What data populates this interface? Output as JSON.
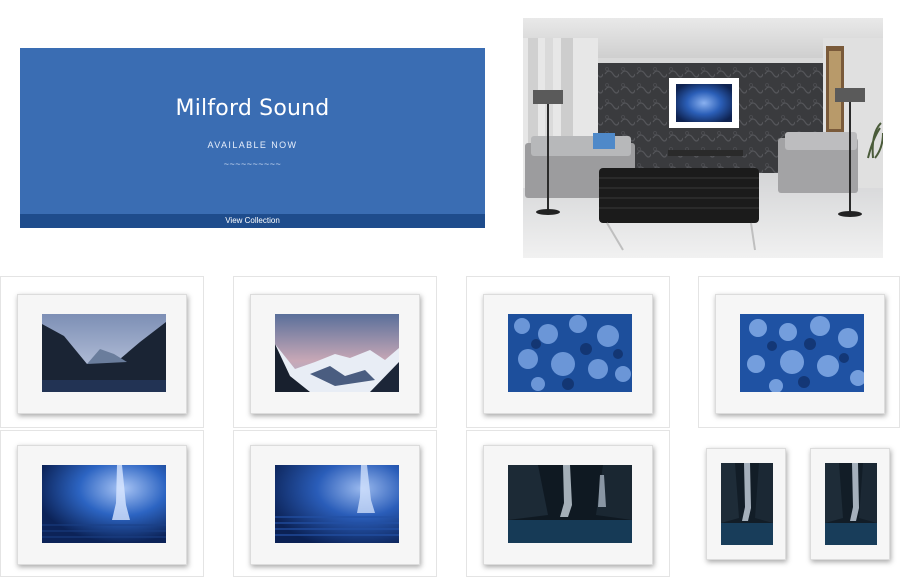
{
  "banner": {
    "title": "Milford Sound",
    "subtitle": "AVAILABLE NOW",
    "divider": "~~~~~~~~~~",
    "cta_label": "View Collection",
    "color": "#3a6db3",
    "cta_color": "#1e4c8c"
  },
  "room_scene": {
    "description_icon": "room-interior-image"
  },
  "gallery": {
    "items": [
      {
        "subject": "fjord-dusk"
      },
      {
        "subject": "fjord-snowy-peaks"
      },
      {
        "subject": "blue-water-texture"
      },
      {
        "subject": "blue-water-texture"
      },
      {
        "subject": "waterfall-mist"
      },
      {
        "subject": "waterfall-ripples"
      },
      {
        "subject": "waterfall-dark"
      },
      {
        "subject": "waterfall-portrait"
      },
      {
        "subject": "waterfall-portrait"
      }
    ]
  }
}
